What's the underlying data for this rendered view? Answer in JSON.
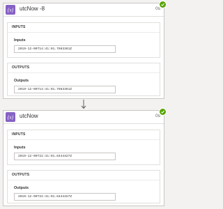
{
  "colors": {
    "accent": "#8661c5",
    "success": "#57a300",
    "border": "#c8c6c4",
    "background": "#f3f2f1"
  },
  "action_icon": "expression-icon",
  "status_icon": "check-icon",
  "connector_icon": "arrow-down-icon",
  "actions": [
    {
      "title": "utcNow -8",
      "duration": "0s",
      "inputs_heading": "INPUTS",
      "inputs_label": "Inputs",
      "inputs_value": "2019-12-09T14:41:01.7663361Z",
      "outputs_heading": "OUTPUTS",
      "outputs_label": "Outputs",
      "outputs_value": "2019-12-09T14:41:01.7663361Z"
    },
    {
      "title": "utcNow",
      "duration": "0s",
      "inputs_heading": "INPUTS",
      "inputs_label": "Inputs",
      "inputs_value": "2019-12-09T22:41:01.8444327Z",
      "outputs_heading": "OUTPUTS",
      "outputs_label": "Outputs",
      "outputs_value": "2019-12-09T22:41:01.8444327Z"
    }
  ]
}
